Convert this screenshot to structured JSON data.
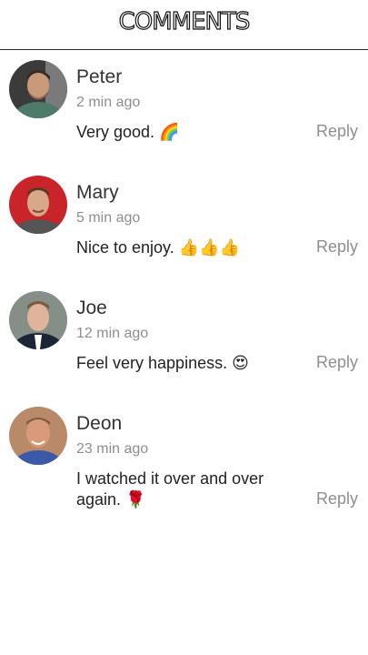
{
  "header": {
    "title": "COMMENTS"
  },
  "comments": [
    {
      "name": "Peter",
      "time": "2 min ago",
      "text": "Very good.",
      "emoji": "🌈",
      "reply": "Reply",
      "avatar": "avatar-peter"
    },
    {
      "name": "Mary",
      "time": "5 min ago",
      "text": "Nice to enjoy.",
      "emoji": "👍👍👍",
      "reply": "Reply",
      "avatar": "avatar-mary"
    },
    {
      "name": "Joe",
      "time": "12 min ago",
      "text": "Feel very happiness.",
      "emoji": "😍",
      "reply": "Reply",
      "avatar": "avatar-joe"
    },
    {
      "name": "Deon",
      "time": "23 min ago",
      "text": "I watched it over and over again.",
      "emoji": "🌹",
      "reply": "Reply",
      "avatar": "avatar-deon"
    }
  ]
}
